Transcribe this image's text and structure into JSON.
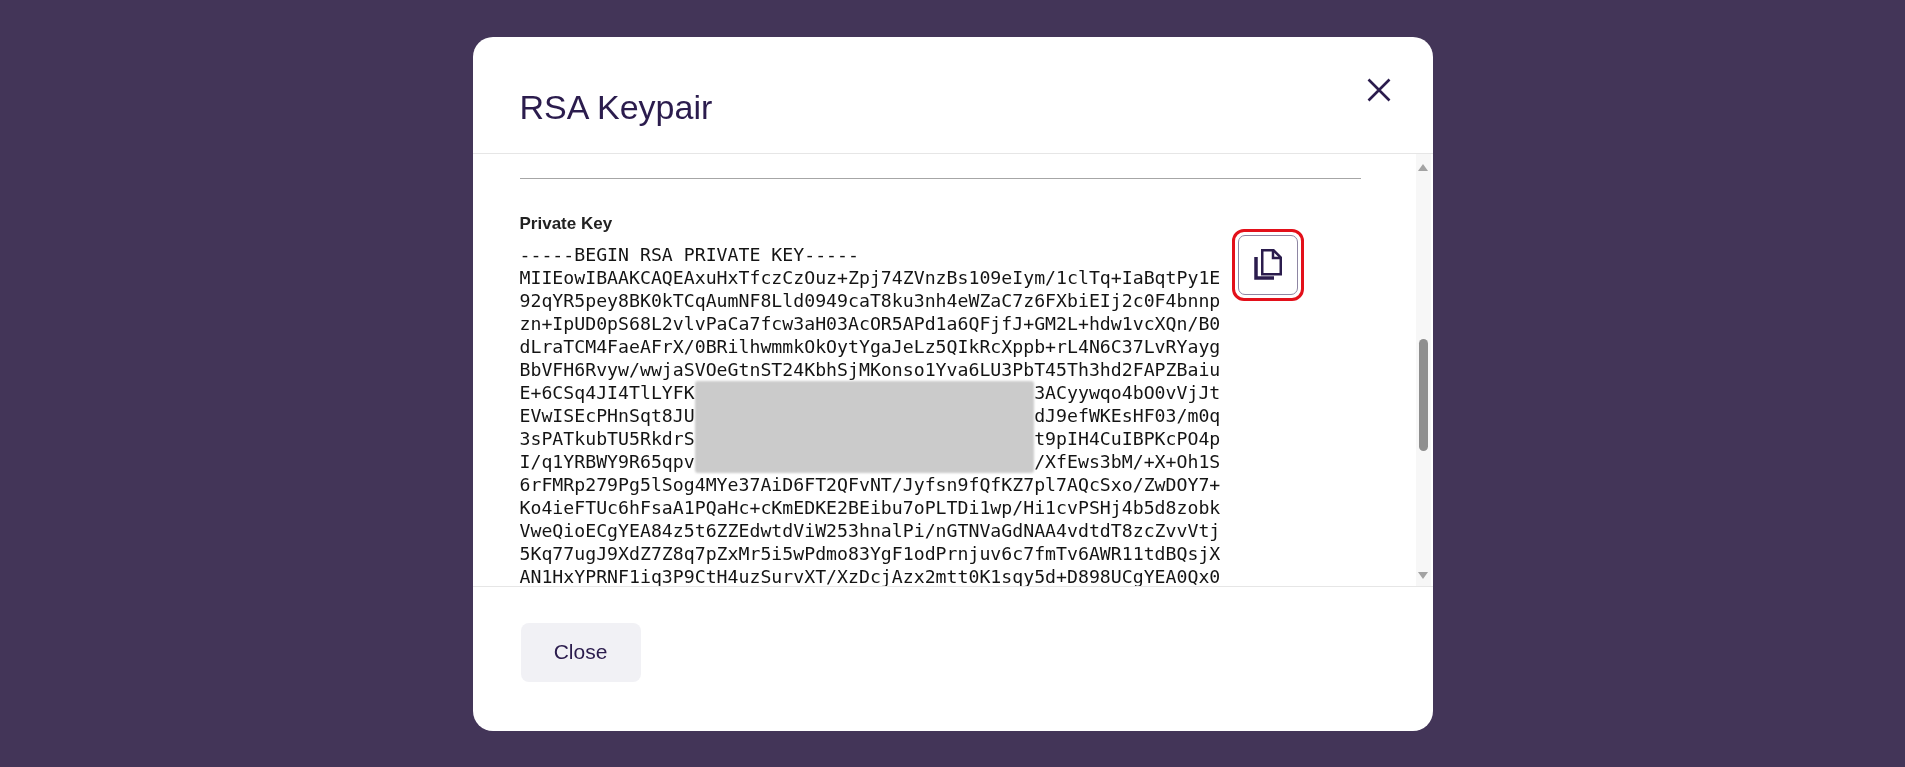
{
  "dialog": {
    "title": "RSA Keypair"
  },
  "key_section": {
    "label": "Private Key",
    "copy_button": {
      "highlighted": true
    },
    "lines": [
      {
        "kind": "full",
        "text": "-----BEGIN RSA PRIVATE KEY-----"
      },
      {
        "kind": "full",
        "text": "MIIEowIBAAKCAQEAxuHxTfczCzOuz+Zpj74ZVnzBs109eIym/1clTq+IaBqtPy1E"
      },
      {
        "kind": "full",
        "text": "92qYR5pey8BK0kTCqAumNF8Lld0949caT8ku3nh4eWZaC7z6FXbiEIj2c0F4bnnp"
      },
      {
        "kind": "full",
        "text": "zn+IpUD0pS68L2vlvPaCa7fcw3aH03AcOR5APd1a6QFjfJ+GM2L+hdw1vcXQn/B0"
      },
      {
        "kind": "full",
        "text": "dLraTCM4FaeAFrX/0BRilhwmmkOkOytYgaJeLz5QIkRcXppb+rL4N6C37LvRYayg"
      },
      {
        "kind": "full",
        "text": "BbVFH6Rvyw/wwjaSVOeGtnST24KbhSjMKonso1Yva6LU3PbT45Th3hd2FAPZBaiu"
      },
      {
        "kind": "redacted",
        "left": "E+6CSq4JI4TlLYFK",
        "right": "3ACyywqo4bO0vVjJt"
      },
      {
        "kind": "redacted",
        "left": "EVwISEcPHnSqt8JU",
        "right": "dJ9efWKEsHF03/m0q"
      },
      {
        "kind": "redacted",
        "left": "3sPATkubTU5RkdrS",
        "right": "t9pIH4CuIBPKcPO4p"
      },
      {
        "kind": "redacted",
        "left": "I/q1YRBWY9R65qpv",
        "right": "/XfEws3bM/+X+Oh1S"
      },
      {
        "kind": "full",
        "text": "6rFMRp279Pg5lSog4MYe37AiD6FT2QFvNT/Jyfsn9fQfKZ7pl7AQcSxo/ZwDOY7+"
      },
      {
        "kind": "full",
        "text": "Ko4ieFTUc6hFsaA1PQaHc+cKmEDKE2BEibu7oPLTDi1wp/Hi1cvPSHj4b5d8zobk"
      },
      {
        "kind": "full",
        "text": "VweQioECgYEA84z5t6ZZEdwtdViW253hnalPi/nGTNVaGdNAA4vdtdT8zcZvvVtj"
      },
      {
        "kind": "full",
        "text": "5Kq77ugJ9XdZ7Z8q7pZxMr5i5wPdmo83YgF1odPrnjuv6c7fmTv6AWR11tdBQsjX"
      },
      {
        "kind": "full",
        "text": "AN1HxYPRNF1iq3P9CtH4uzSurvXT/XzDcjAzx2mtt0K1sqy5d+D898UCgYEA0Qx0"
      }
    ]
  },
  "footer": {
    "buttons": [
      {
        "label": "Close"
      }
    ]
  }
}
